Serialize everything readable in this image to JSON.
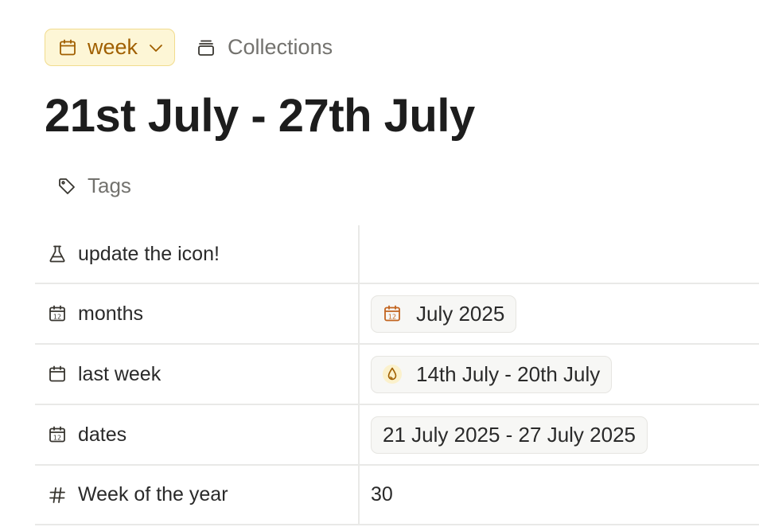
{
  "breadcrumb": {
    "week_label": "week",
    "collections_label": "Collections"
  },
  "page_title": "21st July - 27th July",
  "tags_label": "Tags",
  "properties": [
    {
      "icon": "flask-icon",
      "key": "update the icon!",
      "value": ""
    },
    {
      "icon": "calendar-12-icon",
      "key": "months",
      "value": "July 2025",
      "value_icon": "calendar-12-icon"
    },
    {
      "icon": "calendar-icon",
      "key": "last week",
      "value": "14th July - 20th July",
      "value_icon": "drop-icon"
    },
    {
      "icon": "calendar-12-icon",
      "key": "dates",
      "value": "21 July 2025 - 27 July 2025"
    },
    {
      "icon": "hash-icon",
      "key": "Week of the year",
      "value": "30"
    }
  ],
  "colors": {
    "week_pill_bg": "#fdf6d6",
    "week_pill_text": "#a05f00",
    "accent_orange": "#c2641f",
    "muted_text": "#73726e"
  }
}
